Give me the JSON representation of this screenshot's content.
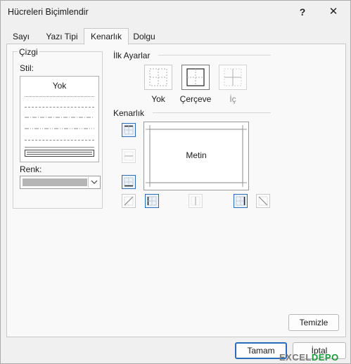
{
  "window": {
    "title": "Hücreleri Biçimlendir",
    "help_label": "?",
    "close_label": "✕"
  },
  "tabs": [
    {
      "label": "Sayı",
      "active": false
    },
    {
      "label": "Yazı Tipi",
      "active": false
    },
    {
      "label": "Kenarlık",
      "active": true
    },
    {
      "label": "Dolgu",
      "active": false
    }
  ],
  "line": {
    "group_title": "Çizgi",
    "style_label": "Stil:",
    "style_none": "Yok",
    "color_label": "Renk:",
    "color_value": "#b5b5b5",
    "line_styles": [
      "none",
      "dotted",
      "dashed",
      "dash-dot",
      "dash-dot-dot",
      "dashed-long",
      "solid-thin",
      "double-selected"
    ]
  },
  "presets": {
    "title": "İlk Ayarlar",
    "items": [
      {
        "label": "Yok",
        "icon": "border-none-icon",
        "disabled": false
      },
      {
        "label": "Çerçeve",
        "icon": "border-outline-icon",
        "disabled": false
      },
      {
        "label": "İç",
        "icon": "border-inside-icon",
        "disabled": true
      }
    ]
  },
  "border": {
    "title": "Kenarlık",
    "preview_text": "Metin"
  },
  "buttons": {
    "clear": "Temizle",
    "ok": "Tamam",
    "cancel": "İptal"
  },
  "watermark": {
    "part1": "EXCEL",
    "part2": "DEPO"
  },
  "colors": {
    "accent": "#2b6cb8",
    "dialog_bg": "#f0f0f0",
    "page_bg": "#f9f9f9"
  }
}
